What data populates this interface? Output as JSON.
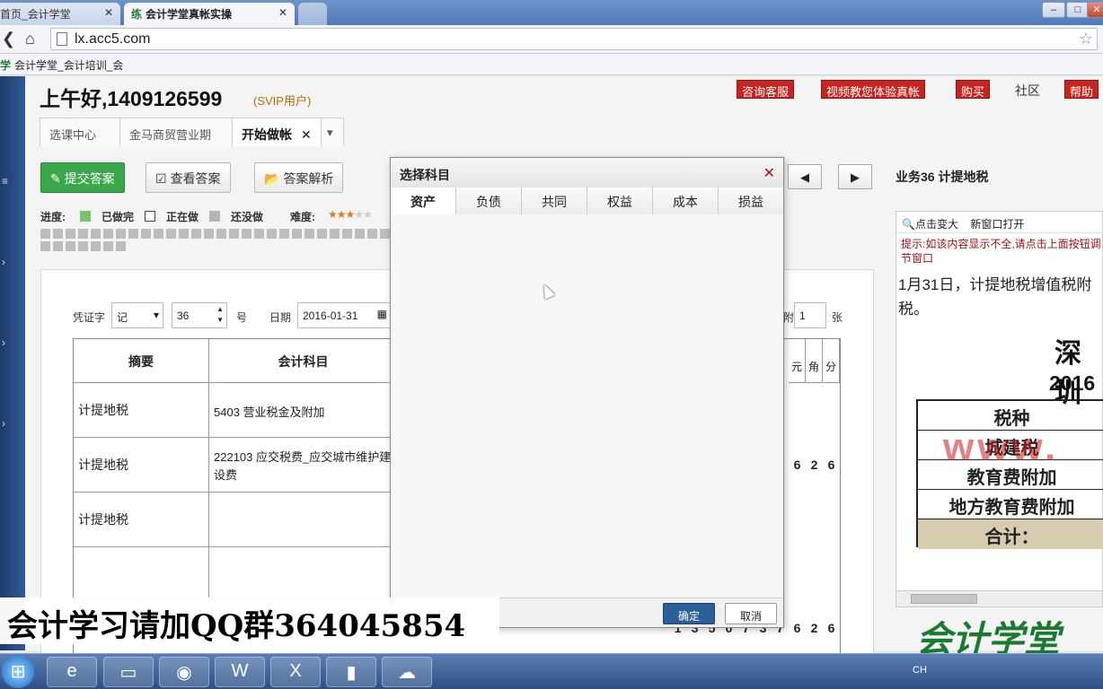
{
  "browser": {
    "tabs": [
      {
        "label": "首页_会计学堂",
        "close": "✕"
      },
      {
        "label": "会计学堂真帐实操",
        "icon": "练",
        "close": "✕"
      }
    ],
    "url": "lx.acc5.com",
    "bookmark": "会计学堂_会计培训_会",
    "bookmark_icon": "学"
  },
  "header": {
    "greeting": "上午好,1409126599",
    "user_level": "(SVIP用户)",
    "buttons": [
      "咨询客服",
      "视频教您体验真帐",
      "购买"
    ],
    "community": "社区",
    "help": "帮助"
  },
  "content_tabs": [
    {
      "label": "选课中心"
    },
    {
      "label": "金马商贸营业期"
    },
    {
      "label": "开始做帐",
      "close": "✕"
    }
  ],
  "actions": {
    "submit": "提交答案",
    "view": "查看答案",
    "analysis": "答案解析"
  },
  "legend": {
    "progress_label": "进度:",
    "done": "已做完",
    "doing": "正在做",
    "todo": "还没做",
    "difficulty_label": "难度:",
    "difficulty_stars": 3,
    "difficulty_max": 5,
    "colors": {
      "done": "#7ac36a",
      "doing": "#ffffff",
      "todo": "#b5b5b5"
    }
  },
  "voucher": {
    "type_label": "凭证字",
    "type_value": "记",
    "number_value": "36",
    "number_suffix": "号",
    "date_label": "日期",
    "date_value": "2016-01-31",
    "attach_partial": "附",
    "attach_value": "1",
    "attach_unit": "张",
    "headers": {
      "summary": "摘要",
      "account": "会计科目",
      "yuan": "元",
      "jiao": "角",
      "fen": "分"
    },
    "rows": [
      {
        "summary": "计提地税",
        "account": "5403 营业税金及附加",
        "amount_tail": ""
      },
      {
        "summary": "计提地税",
        "account": "222103 应交税费_应交城市维护建设费",
        "amount_tail": "626"
      },
      {
        "summary": "计提地税",
        "account": "",
        "amount_tail": ""
      }
    ],
    "total_digits": "1350737626"
  },
  "modal": {
    "title": "选择科目",
    "close": "✕",
    "tabs": [
      "资产",
      "负债",
      "共同",
      "权益",
      "成本",
      "损益"
    ],
    "ok": "确定",
    "cancel": "取消"
  },
  "right": {
    "prev": "◀",
    "next": "▶",
    "business_title": "业务36 计提地税",
    "zoom": "点击变大",
    "new_window": "新窗口打开",
    "hint": "提示:如该内容显示不全,请点击上面按钮调节窗口",
    "description": "1月31日，计提地税增值税附税。",
    "big1": "深圳",
    "big2": "2016",
    "tax_rows": [
      "税种",
      "城建税",
      "教育费附加",
      "地方教育费附加",
      "合计："
    ],
    "watermark": "www."
  },
  "overlay": {
    "qq": "会计学习请加QQ群364045854",
    "logo": "会计学堂"
  },
  "taskbar": {
    "tray_lang": "CH",
    "icons": [
      "ie-icon",
      "folder-icon",
      "chrome-icon",
      "word-icon",
      "excel-icon",
      "media-icon",
      "chat-icon"
    ]
  }
}
